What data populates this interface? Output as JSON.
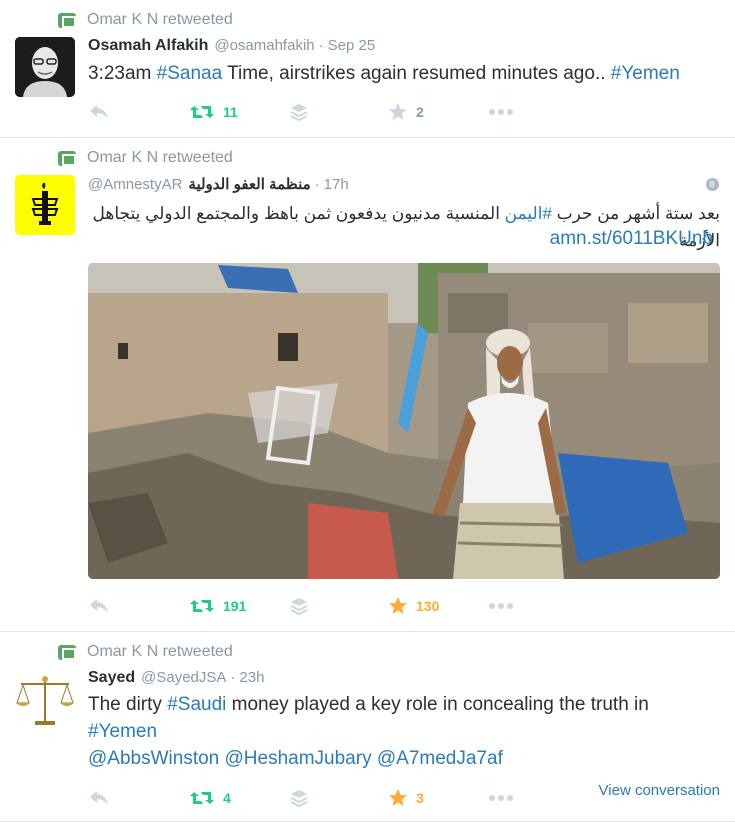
{
  "tweets": [
    {
      "retweeted_by": "Omar K N retweeted",
      "fullname": "Osamah Alfakih",
      "username": "@osamahfakih",
      "separator": "·",
      "time": "Sep 25",
      "text_plain_1": "3:23am ",
      "hashtag_1": "#Sanaa",
      "text_plain_2": " Time, airstrikes again resumed minutes ago.. ",
      "hashtag_2": "#Yemen",
      "retweets": "11",
      "favorites": "2",
      "favorited": false
    },
    {
      "retweeted_by": "Omar K N retweeted",
      "fullname": "منظمة العفو الدولية",
      "username": "@AmnestyAR",
      "separator": "·",
      "time": "17h",
      "arabic_text_1": "بعد ستة أشهر من حرب ",
      "arabic_hashtag": "#اليمن",
      "arabic_text_2": " المنسية مدنيون يدفعون ثمن باهظ  والمجتمع الدولي يتجاهل الأزمة",
      "link": "amn.st/6011BKUnb",
      "retweets": "191",
      "favorites": "130",
      "favorited": true
    },
    {
      "retweeted_by": "Omar K N retweeted",
      "fullname": "Sayed",
      "username": "@SayedJSA",
      "separator": "·",
      "time": "23h",
      "text_plain_1": "The dirty ",
      "hashtag_1": "#Saudi",
      "text_plain_2": "  money played a key role in concealing the truth in",
      "hashtag_2": "#Yemen",
      "mention_1": "@AbbsWinston",
      "mention_2": "@HeshamJubary",
      "mention_3": "@A7medJa7af",
      "retweets": "4",
      "favorites": "3",
      "favorited": true,
      "view_conversation": "View conversation"
    }
  ],
  "colors": {
    "link": "#2b7bb9",
    "retweet_green": "#19cf86",
    "star_gold": "#ffac33",
    "muted": "#8899a6",
    "icon_gray": "#ccd6dd"
  }
}
